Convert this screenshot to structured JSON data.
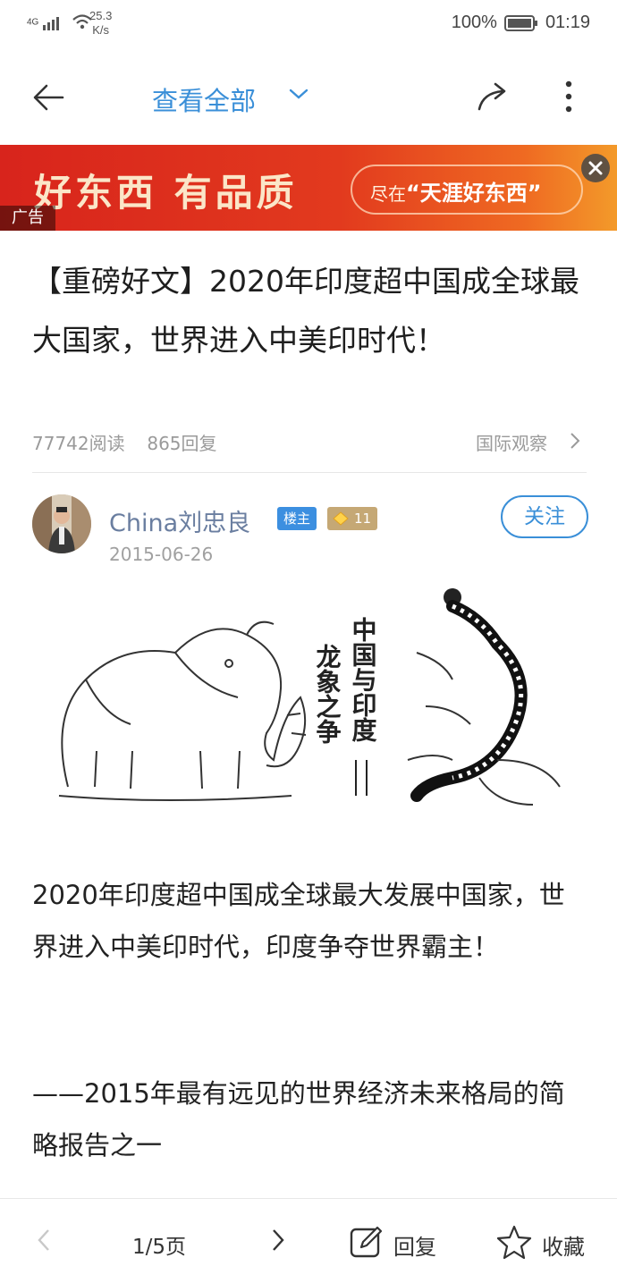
{
  "status_bar": {
    "network": "4G",
    "speed_value": "25.3",
    "speed_unit": "K/s",
    "battery": "100%",
    "time": "01:19"
  },
  "nav": {
    "title": "查看全部",
    "icons": [
      "back-arrow-icon",
      "chevron-down-icon",
      "share-icon",
      "more-vertical-icon"
    ]
  },
  "ad": {
    "slogan": "好东西 有品质",
    "pill_prefix": "尽在",
    "pill_brand": "“天涯好东西”",
    "tag": "广告",
    "colors": {
      "start": "#d8241c",
      "end": "#f39a2a"
    }
  },
  "article": {
    "title": "【重磅好文】2020年印度超中国成全球最大国家，世界进入中美印时代！",
    "reads": "77742阅读",
    "replies": "865回复",
    "category": "国际观察"
  },
  "author": {
    "name": "China刘忠良",
    "owner_badge": "楼主",
    "level": "11",
    "date": "2015-06-26",
    "follow_label": "关注"
  },
  "illustration": {
    "text_right": "中国与印度",
    "text_left": "龙象之争"
  },
  "body": {
    "paragraph_1": "2020年印度超中国成全球最大发展中国家，世界进入中美印时代，印度争夺世界霸主！",
    "paragraph_2": "——2015年最有远见的世界经济未来格局的简略报告之一"
  },
  "bottom_bar": {
    "page": "1/5页",
    "reply_label": "回复",
    "favorite_label": "收藏"
  },
  "colors": {
    "accent": "#3a8fd8",
    "author_name": "#6a7ea0",
    "meta": "#9a9a9a"
  }
}
